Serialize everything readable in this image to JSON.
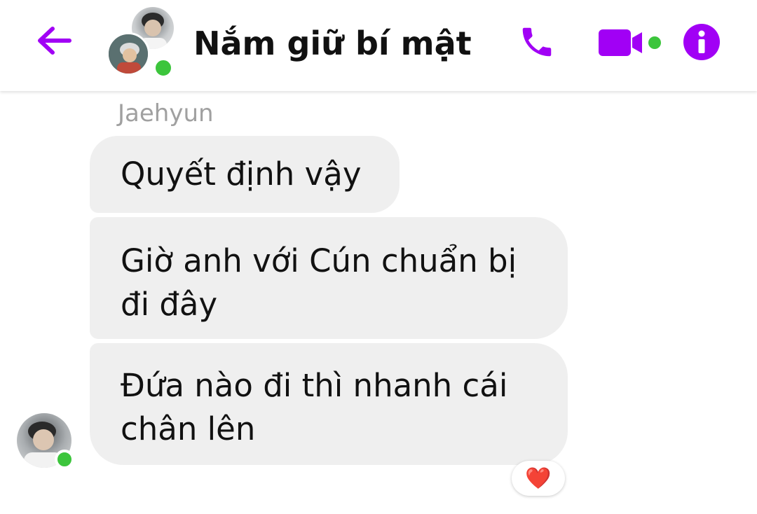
{
  "header": {
    "title": "Nắm giữ bí mật",
    "back_icon": "arrow-left-icon",
    "call_icon": "phone-icon",
    "video_icon": "video-camera-icon",
    "info_icon": "info-icon",
    "accent_color": "#a100f5",
    "online_color": "#3cc53c"
  },
  "chat": {
    "sender_name": "Jaehyun",
    "messages": [
      {
        "text": "Quyết định vậy"
      },
      {
        "text": "Giờ anh với Cún chuẩn bị đi đây"
      },
      {
        "text": "Đứa nào đi thì nhanh cái chân lên"
      }
    ],
    "reaction": "❤️"
  }
}
